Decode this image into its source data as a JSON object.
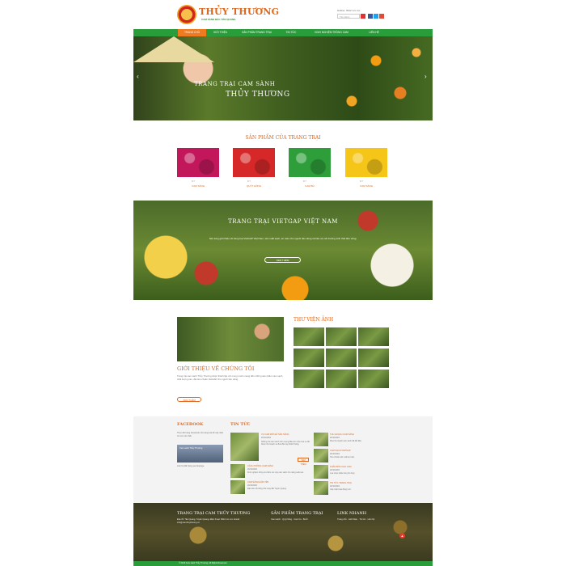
{
  "header": {
    "brand": "THỦY THƯƠNG",
    "tagline": "CAM SÀNH BẮC TÂN QUANG",
    "hotline": "Hotline: 0912 xxx xxx",
    "search_placeholder": "Tìm kiếm"
  },
  "nav": {
    "items": [
      {
        "label": "TRANG CHỦ"
      },
      {
        "label": "GIỚI THIỆU"
      },
      {
        "label": "SẢN PHẨM TRANG TRẠI"
      },
      {
        "label": "TIN TỨC"
      },
      {
        "label": "KINH NGHIỆM TRỒNG CAM"
      },
      {
        "label": "LIÊN HỆ"
      }
    ]
  },
  "hero": {
    "line1": "TRANG TRẠI CAM SÀNH",
    "line2": "THỦY THƯƠNG"
  },
  "products": {
    "title": "SẢN PHẨM CỦA TRANG TRẠI",
    "items": [
      {
        "name": "CAM SÀNH",
        "price": "0 ₫",
        "color": "#c2185b"
      },
      {
        "name": "QUÝT HỒNG",
        "price": "0 ₫",
        "color": "#d62828"
      },
      {
        "name": "CAM BÙ",
        "price": "0 ₫",
        "color": "#2e9e3a"
      },
      {
        "name": "CAM SÀNH",
        "price": "0 ₫",
        "color": "#f5c518"
      }
    ]
  },
  "vietgap": {
    "title": "TRANG TRẠI VIETGAP VIỆT NAM",
    "text": "Nội dung giới thiệu về trang trại VietGAP Việt Nam, sản xuất sạch, an toàn cho người tiêu dùng và bảo vệ môi trường sinh thái bền vững.",
    "button": "XEM THÊM"
  },
  "intro": {
    "title": "GIỚI THIỆU VỀ CHÚNG TÔI",
    "text": "Trang trại cam sành Thủy Thương được thành lập với mong muốn mang đến những sản phẩm cam sạch, chất lượng cao, đạt tiêu chuẩn VietGAP cho người tiêu dùng.",
    "button": "XEM THÊM"
  },
  "gallery": {
    "title": "THƯ VIỆN ẢNH",
    "count": 9
  },
  "facebook": {
    "title": "FACEBOOK",
    "text": "Theo dõi trang Facebook của trang trại để cập nhật tin tức mới nhất.",
    "page_name": "Cam sành Thủy Thương",
    "sub": "Liên hệ đặt hàng qua fanpage."
  },
  "news": {
    "title": "TIN TỨC",
    "big": {
      "title": "VỤ CAM MỚI ĐÃ SẴN SÀNG",
      "date": "20/10/2016",
      "excerpt": "Những trái cam sành chín mọng đầu tiên của mùa vụ đã được thu hoạch và đưa đến tay khách hàng."
    },
    "more": "XEM THÊM",
    "left": [
      {
        "title": "CÁCH TRỒNG CAM SÀNH",
        "date": "20/10/2016",
        "excerpt": "Kinh nghiệm trồng và chăm sóc cây cam sành cho năng suất cao."
      },
      {
        "title": "CAM SÀNH HÀM YÊN",
        "date": "20/10/2016",
        "excerpt": "Đặc sản nổi tiếng của vùng đất Tuyên Quang."
      }
    ],
    "right": [
      {
        "title": "THU HOẠCH CAM SÀNH",
        "date": "20/10/2016",
        "excerpt": "Mùa thu hoạch cam sành đã bắt đầu."
      },
      {
        "title": "CAM SẠCH VIETGAP",
        "date": "20/10/2016",
        "excerpt": "Tiêu chuẩn sản xuất an toàn."
      },
      {
        "title": "PHÂN BÓN CHO CAM",
        "date": "20/10/2016",
        "excerpt": "Lựa chọn phân bón phù hợp."
      },
      {
        "title": "TIN TỨC TRANG TRẠI",
        "date": "20/10/2016",
        "excerpt": "Cập nhật hoạt động mới."
      }
    ]
  },
  "footer": {
    "col1": {
      "title": "TRANG TRẠI CAM THỦY THƯƠNG",
      "text": "Địa chỉ: Tân Quang, Tuyên Quang. Điện thoại: 0912 xxx xxx. Email: info@camthuythuong.vn"
    },
    "col2": {
      "title": "SẢN PHẨM TRANG TRẠI",
      "text": "Cam sành · Quýt hồng · Cam bù · Bưởi"
    },
    "col3": {
      "title": "LINK NHANH",
      "text": "Trang chủ · Giới thiệu · Tin tức · Liên hệ"
    },
    "copyright": "© 2016 Cam sành Thủy Thương. All Rights Reserved."
  }
}
